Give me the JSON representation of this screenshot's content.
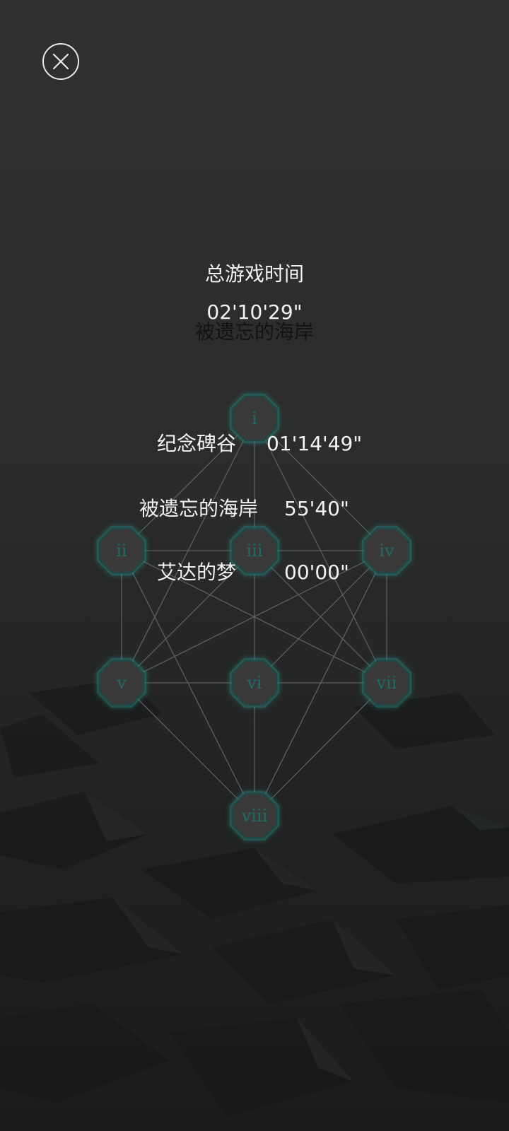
{
  "total": {
    "title": "总游戏时间",
    "time": "02'10'29\""
  },
  "current_chapter": "被遗忘的海岸",
  "chapters": [
    {
      "name": "纪念碑谷",
      "time": "01'14'49\""
    },
    {
      "name": "被遗忘的海岸",
      "time": "55'40\""
    },
    {
      "name": "艾达的梦",
      "time": "00'00\""
    }
  ],
  "nodes": [
    {
      "id": "i",
      "label": "i"
    },
    {
      "id": "ii",
      "label": "ii"
    },
    {
      "id": "iii",
      "label": "iii"
    },
    {
      "id": "iv",
      "label": "iv"
    },
    {
      "id": "v",
      "label": "v"
    },
    {
      "id": "vi",
      "label": "vi"
    },
    {
      "id": "vii",
      "label": "vii"
    },
    {
      "id": "viii",
      "label": "viii"
    }
  ],
  "icons": {
    "close": "close-icon"
  },
  "colors": {
    "text": "#f2f2f2",
    "node_fill": "#3a3a3a",
    "node_glow": "#2c7f79",
    "node_label": "#1f6b66"
  }
}
